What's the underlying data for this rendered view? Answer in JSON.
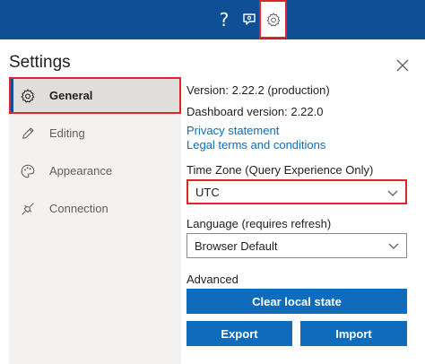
{
  "topbar": {
    "help_glyph": "?",
    "icons": [
      "help-icon",
      "feedback-icon",
      "gear-icon"
    ],
    "background_color": "#0f4f93"
  },
  "panel": {
    "title": "Settings",
    "close_icon": "close-icon"
  },
  "sidebar": {
    "items": [
      {
        "label": "General",
        "icon": "gear-icon",
        "active": true
      },
      {
        "label": "Editing",
        "icon": "pencil-icon",
        "active": false
      },
      {
        "label": "Appearance",
        "icon": "palette-icon",
        "active": false
      },
      {
        "label": "Connection",
        "icon": "plug-icon",
        "active": false
      }
    ]
  },
  "general": {
    "version": "Version: 2.22.2 (production)",
    "dashboard_version": "Dashboard version: 2.22.0",
    "privacy_link": "Privacy statement",
    "legal_link": "Legal terms and conditions",
    "timezone_label": "Time Zone (Query Experience Only)",
    "timezone_value": "UTC",
    "language_label": "Language (requires refresh)",
    "language_value": "Browser Default",
    "advanced_label": "Advanced",
    "clear_button": "Clear local state",
    "export_button": "Export",
    "import_button": "Import"
  },
  "colors": {
    "accent": "#0f6cbd",
    "highlight": "#e0242b"
  }
}
